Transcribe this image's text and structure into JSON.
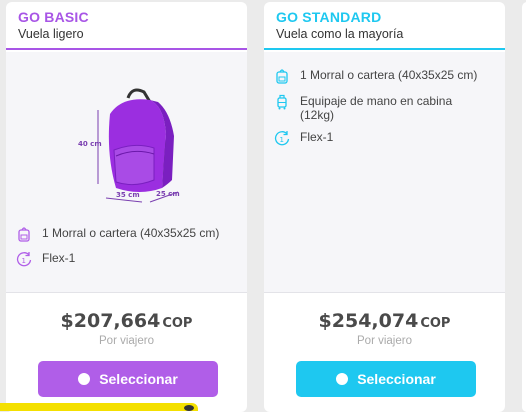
{
  "plans": [
    {
      "name": "GO BASIC",
      "subtitle": "Vuela ligero",
      "accent": "#a855e6",
      "button_color": "#b05ee8",
      "features": [
        {
          "icon": "backpack-icon",
          "text": "1 Morral o cartera (40x35x25 cm)"
        },
        {
          "icon": "flex-icon",
          "text": "Flex-1"
        }
      ],
      "image_labels": {
        "height": "40 cm",
        "width": "35 cm",
        "depth": "25 cm"
      },
      "price": "$207,664",
      "currency": "COP",
      "per": "Por viajero",
      "button_label": "Seleccionar"
    },
    {
      "name": "GO STANDARD",
      "subtitle": "Vuela como la mayoría",
      "accent": "#1ec8f0",
      "button_color": "#1ec8f0",
      "features": [
        {
          "icon": "backpack-icon",
          "text": "1 Morral o cartera (40x35x25 cm)"
        },
        {
          "icon": "carry-on-suitcase-icon",
          "text": "Equipaje de mano en cabina (12kg)"
        },
        {
          "icon": "flex-icon",
          "text": "Flex-1"
        }
      ],
      "price": "$254,074",
      "currency": "COP",
      "per": "Por viajero",
      "button_label": "Seleccionar"
    }
  ]
}
